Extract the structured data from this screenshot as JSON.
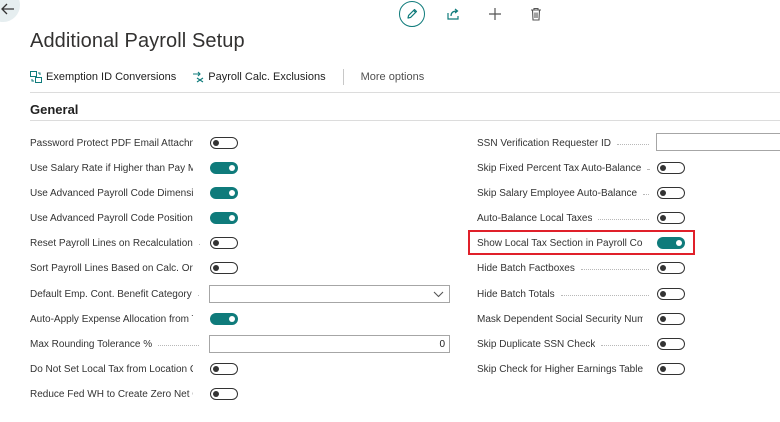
{
  "page": {
    "title": "Additional Payroll Setup"
  },
  "icons": {
    "back": "arrow-left-icon",
    "edit": "pencil-icon",
    "share": "share-icon",
    "add": "plus-icon",
    "delete": "trash-icon",
    "accent_color": "#0f7b7b",
    "highlight_color": "#e0202a"
  },
  "actionbar": {
    "exemption": "Exemption ID Conversions",
    "exclusions": "Payroll Calc. Exclusions",
    "more": "More options"
  },
  "section": {
    "title": "General"
  },
  "left_fields": [
    {
      "label": "Password Protect PDF Email Attachme...",
      "type": "toggle",
      "value": false
    },
    {
      "label": "Use Salary Rate if Higher than Pay Ma...",
      "type": "toggle",
      "value": true
    },
    {
      "label": "Use Advanced Payroll Code Dimensions",
      "type": "toggle",
      "value": true
    },
    {
      "label": "Use Advanced Payroll Code Position / ...",
      "type": "toggle",
      "value": true
    },
    {
      "label": "Reset Payroll Lines on Recalculation",
      "type": "toggle",
      "value": false
    },
    {
      "label": "Sort Payroll Lines Based on Calc. Order",
      "type": "toggle",
      "value": false
    },
    {
      "label": "Default Emp. Cont. Benefit Category",
      "type": "select",
      "value": ""
    },
    {
      "label": "Auto-Apply Expense Allocation from T...",
      "type": "toggle",
      "value": true
    },
    {
      "label": "Max Rounding Tolerance %",
      "type": "number",
      "value": "0"
    },
    {
      "label": "Do Not Set Local Tax from Location C...",
      "type": "toggle",
      "value": false
    },
    {
      "label": "Reduce Fed WH to Create Zero Net C...",
      "type": "toggle",
      "value": false
    }
  ],
  "right_fields": [
    {
      "label": "SSN Verification Requester ID",
      "type": "text",
      "value": ""
    },
    {
      "label": "Skip Fixed Percent Tax Auto-Balance",
      "type": "toggle",
      "value": false
    },
    {
      "label": "Skip Salary Employee Auto-Balance",
      "type": "toggle",
      "value": false
    },
    {
      "label": "Auto-Balance Local Taxes",
      "type": "toggle",
      "value": false
    },
    {
      "label": "Show Local Tax Section in Payroll Cod...",
      "type": "toggle",
      "value": true
    },
    {
      "label": "Hide Batch Factboxes",
      "type": "toggle",
      "value": false
    },
    {
      "label": "Hide Batch Totals",
      "type": "toggle",
      "value": false
    },
    {
      "label": "Mask Dependent Social Security Num...",
      "type": "toggle",
      "value": false
    },
    {
      "label": "Skip Duplicate SSN Check",
      "type": "toggle",
      "value": false
    },
    {
      "label": "Skip Check for Higher Earnings Table ...",
      "type": "toggle",
      "value": false
    }
  ]
}
